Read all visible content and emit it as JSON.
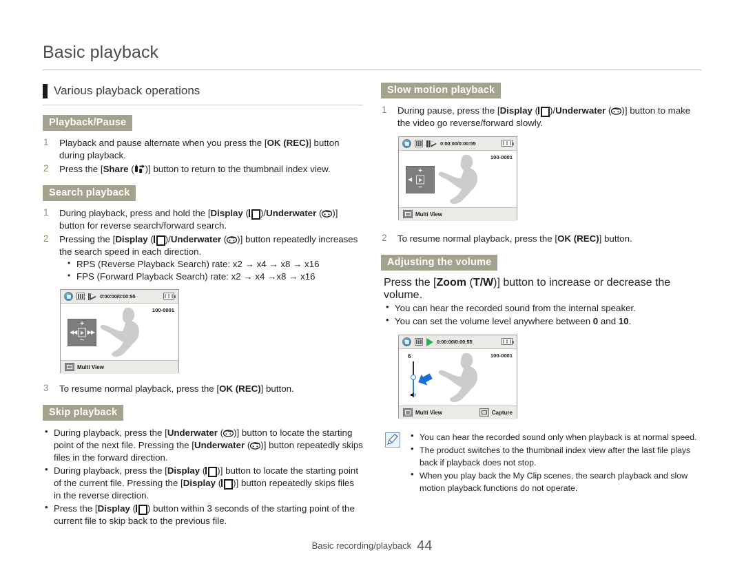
{
  "document": {
    "title": "Basic playback",
    "footer_text": "Basic recording/playback",
    "page_number": "44"
  },
  "section": {
    "heading": "Various playback operations"
  },
  "left_column": {
    "playback_pause": {
      "badge": "Playback/Pause",
      "steps": [
        {
          "num": "1",
          "text_before": "Playback and pause alternate when you press the [",
          "bold": "OK (REC)",
          "text_after": "] button during playback."
        },
        {
          "num": "2",
          "text_before": "Press the [",
          "bold": "Share",
          "icon": "share-icon",
          "text_after": ")] button to return to the thumbnail index view."
        }
      ]
    },
    "search_playback": {
      "badge": "Search playback",
      "step1": {
        "num": "1",
        "t1": "During playback, press and hold the [",
        "b1": "Display",
        "t2": "(",
        "b2": "Underwater",
        "t3": ")] button for reverse search/forward search."
      },
      "step2": {
        "num": "2",
        "t1": "Pressing the [",
        "b1": "Display",
        "b2": "Underwater",
        "t2": ")] button repeatedly increases the search speed in each direction."
      },
      "rates": [
        "RPS (Reverse Playback Search) rate: x2 → x4 → x8 → x16",
        "FPS (Forward Playback Search) rate: x2 → x4 →x8 → x16"
      ],
      "step3": {
        "num": "3",
        "t1": "To resume normal playback, press the [",
        "b1": "OK (REC)",
        "t2": "] button."
      }
    },
    "skip_playback": {
      "badge": "Skip playback",
      "bullets": [
        {
          "t1": "During playback, press the [",
          "b1": "Underwater",
          "t2": ")] button to locate the starting point of the next file. Pressing the [",
          "b2": "Underwater",
          "t3": ")] button repeatedly skips files in the forward direction."
        },
        {
          "t1": "During playback, press the [",
          "b1": "Display",
          "t2": ")] button to locate the starting point of the current file. Pressing the [",
          "b2": "Display",
          "t3": ")] button repeatedly skips files in the reverse direction."
        },
        {
          "t1": "Press the [",
          "b1": "Display",
          "t2": ") button within 3 seconds of the starting point of the current file to skip back to the previous file."
        }
      ]
    },
    "lcd": {
      "time": "0:00:00/0:00:55",
      "file_number": "100-0001",
      "bottom_left_label": "Multi View",
      "pad": {
        "plus": "+",
        "minus": "−",
        "left": "◀◀",
        "right": "▶▶"
      }
    }
  },
  "right_column": {
    "slow_motion": {
      "badge": "Slow motion playback",
      "step1": {
        "num": "1",
        "t1": "During pause, press the [",
        "b1": "Display",
        "b2": "Underwater",
        "t2": ")] button to make the video go reverse/forward slowly."
      },
      "step2": {
        "num": "2",
        "t1": "To resume normal playback, press the [",
        "b1": "OK (REC)",
        "t2": "] button."
      },
      "lcd": {
        "time": "0:00:00/0:00:55",
        "file_number": "100-0001",
        "bottom_left_label": "Multi View",
        "pad": {
          "plus": "+",
          "minus": "−",
          "left": "◀",
          "right": ""
        }
      }
    },
    "volume": {
      "badge": "Adjusting the volume",
      "intro": {
        "t1": "Press the [",
        "b1": "Zoom",
        "t2": "(",
        "b2": "T/W",
        "t3": ")] button to increase or decrease the volume."
      },
      "bullets": [
        {
          "t1": "You can hear the recorded sound from the internal speaker."
        },
        {
          "t1": "You can set the volume level anywhere between ",
          "b1": "0",
          "t2": " and ",
          "b2": "10",
          "t3": "."
        }
      ],
      "lcd": {
        "time": "0:00:00/0:00:55",
        "file_number": "100-0001",
        "bottom_left_label": "Multi View",
        "bottom_right_label": "Capture",
        "volume_level": "6"
      }
    },
    "note": {
      "icon": "note-pen-icon",
      "bullets": [
        "You can hear the recorded sound only when playback is at normal speed.",
        "The product switches to the thumbnail index view after the last file plays back if playback does not stop.",
        "When you play back the My Clip scenes, the search playback and slow motion playback functions do not operate."
      ]
    }
  },
  "colors": {
    "badge_bg": "#a3a28c",
    "step_number": "#8c8c75",
    "title": "#4c4c4c",
    "note_border": "#7b9cc4",
    "accent_blue": "#1f7fe0"
  }
}
